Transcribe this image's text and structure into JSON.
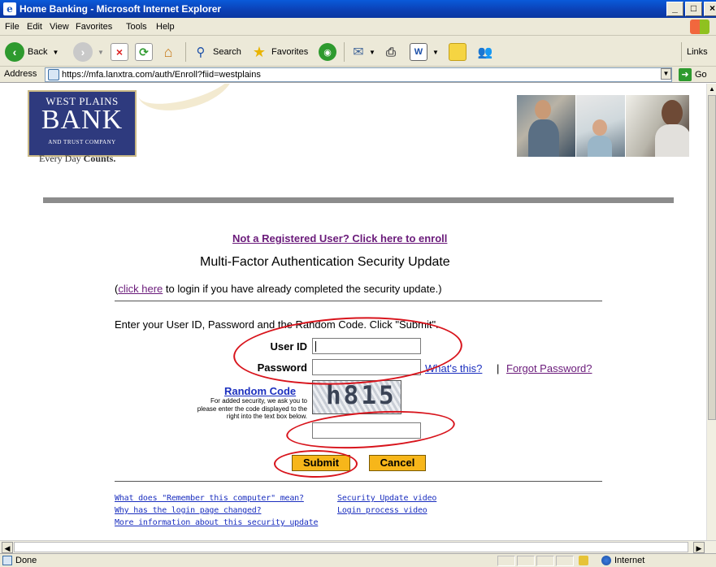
{
  "window": {
    "title": "Home Banking - Microsoft Internet Explorer",
    "controls": [
      "_",
      "□",
      "×"
    ]
  },
  "menu": [
    "File",
    "Edit",
    "View",
    "Favorites",
    "Tools",
    "Help"
  ],
  "toolbar": {
    "back_label": "Back",
    "search_label": "Search",
    "favorites_label": "Favorites",
    "links_label": "Links"
  },
  "address": {
    "label": "Address",
    "url": "https://mfa.lanxtra.com/auth/Enroll?fiid=westplains",
    "go_label": "Go"
  },
  "bank": {
    "logo_line1": "WEST PLAINS",
    "logo_line2": "BANK",
    "logo_line3": "AND TRUST COMPANY",
    "tagline_prefix": "Every Day ",
    "tagline_bold": "Counts."
  },
  "page": {
    "enroll_link": "Not a Registered User? Click here to enroll",
    "title": "Multi-Factor Authentication Security Update",
    "login_note_open": "(",
    "login_note_link": "click here",
    "login_note_rest": " to login if you have already completed the security update.)",
    "instructions": "Enter your User ID, Password and the Random Code. Click \"Submit\".",
    "userid_label": "User ID",
    "password_label": "Password",
    "whats_this": "What's this?",
    "separator": "|",
    "forgot_password": "Forgot Password?",
    "random_code_title": "Random Code",
    "random_code_help": "For added security, we ask you to please enter the code displayed to the right into the text box below.",
    "captcha_text": "h815",
    "submit_label": "Submit",
    "cancel_label": "Cancel"
  },
  "footer_links": {
    "left": [
      "What does \"Remember this computer\" mean?",
      "Why has the login page changed?",
      "More information about this security update"
    ],
    "right": [
      "Security Update video",
      "Login process video"
    ]
  },
  "status": {
    "text": "Done",
    "zone": "Internet"
  },
  "colors": {
    "link_visited": "#6a1a7a",
    "link": "#1b2fbf",
    "button_fill": "#f7b61a",
    "annotation_red": "#d8141c",
    "bank_navy": "#2e3a7e"
  }
}
